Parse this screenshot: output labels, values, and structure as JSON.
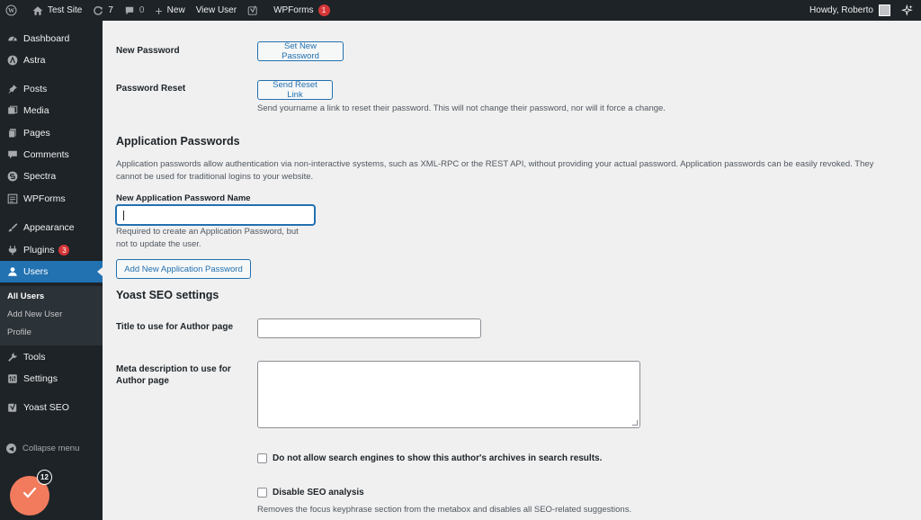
{
  "adminbar": {
    "site_name": "Test Site",
    "updates_count": "7",
    "comments_count": "0",
    "new_label": "New",
    "view_user_label": "View User",
    "wpforms_label": "WPForms",
    "wpforms_badge": "1",
    "howdy_label": "Howdy, Roberto"
  },
  "sidebar": {
    "items": [
      {
        "label": "Dashboard",
        "icon": "dashboard-icon"
      },
      {
        "label": "Astra",
        "icon": "astra-icon"
      },
      {
        "label": "Posts",
        "icon": "pin-icon"
      },
      {
        "label": "Media",
        "icon": "media-icon"
      },
      {
        "label": "Pages",
        "icon": "pages-icon"
      },
      {
        "label": "Comments",
        "icon": "comments-icon"
      },
      {
        "label": "Spectra",
        "icon": "spectra-icon"
      },
      {
        "label": "WPForms",
        "icon": "wpforms-icon"
      },
      {
        "label": "Appearance",
        "icon": "brush-icon"
      },
      {
        "label": "Plugins",
        "icon": "plugin-icon",
        "badge": "3"
      },
      {
        "label": "Users",
        "icon": "users-icon"
      },
      {
        "label": "Tools",
        "icon": "tools-icon"
      },
      {
        "label": "Settings",
        "icon": "settings-icon"
      },
      {
        "label": "Yoast SEO",
        "icon": "yoast-icon"
      }
    ],
    "submenu": [
      "All Users",
      "Add New User",
      "Profile"
    ],
    "collapse_label": "Collapse menu",
    "float_badge": "12"
  },
  "main": {
    "new_password_label": "New Password",
    "set_new_password_button": "Set New Password",
    "password_reset_label": "Password Reset",
    "send_reset_link_button": "Send Reset Link",
    "password_reset_desc": "Send yourname a link to reset their password. This will not change their password, nor will it force a change.",
    "app_passwords_title": "Application Passwords",
    "app_passwords_desc_line1": "Application passwords allow authentication via non-interactive systems, such as XML-RPC or the REST API, without providing your actual password. Application passwords can be easily revoked. They",
    "app_passwords_desc_line2": "cannot be used for traditional logins to your website.",
    "new_app_password_name_label": "New Application Password Name",
    "new_app_password_value": "",
    "app_password_help_line1": "Required to create an Application Password, but",
    "app_password_help_line2": "not to update the user.",
    "add_app_password_button": "Add New Application Password",
    "yoast_title": "Yoast SEO settings",
    "author_title_label": "Title to use for Author page",
    "author_title_value": "",
    "meta_desc_label_line1": "Meta description to use for",
    "meta_desc_label_line2": "Author page",
    "meta_desc_value": "",
    "noindex_label": "Do not allow search engines to show this author's archives in search results.",
    "noindex_checked": false,
    "disable_seo_label": "Disable SEO analysis",
    "disable_seo_checked": false,
    "disable_seo_desc": "Removes the focus keyphrase section from the metabox and disables all SEO-related suggestions."
  },
  "colors": {
    "adminbar_bg": "#1d2327",
    "accent": "#2271b1",
    "badge": "#d63638",
    "float_button": "#f27b5d"
  }
}
